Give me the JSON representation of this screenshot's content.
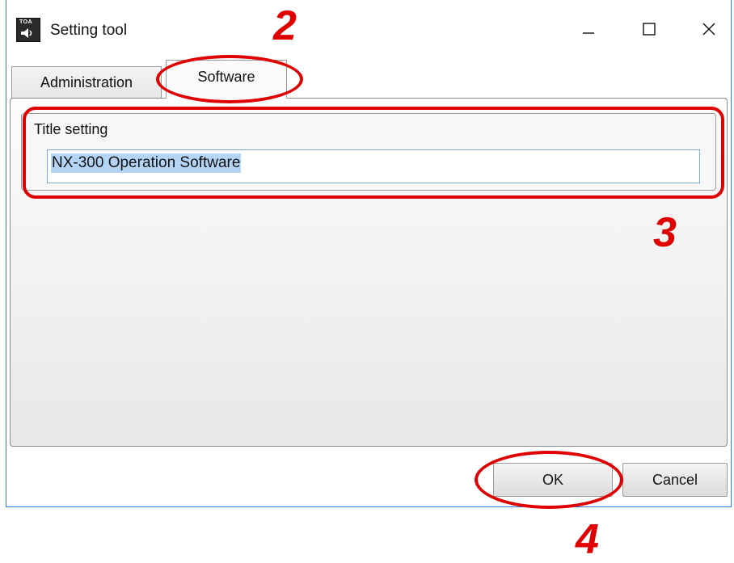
{
  "window": {
    "title": "Setting tool",
    "app_icon_text": "TOA",
    "controls": [
      "minimize-icon",
      "maximize-icon",
      "close-icon"
    ]
  },
  "tabs": [
    {
      "label": "Administration",
      "selected": false
    },
    {
      "label": "Software",
      "selected": true
    }
  ],
  "title_setting": {
    "group_label": "Title setting",
    "value": "NX-300 Operation Software",
    "selected": true
  },
  "buttons": {
    "ok": "OK",
    "cancel": "Cancel"
  },
  "annotations": {
    "step_tab": "2",
    "step_group": "3",
    "step_ok": "4",
    "color": "#e00000"
  },
  "colors": {
    "window_border": "#2b79d8",
    "selection_highlight": "#b5d5f7"
  }
}
